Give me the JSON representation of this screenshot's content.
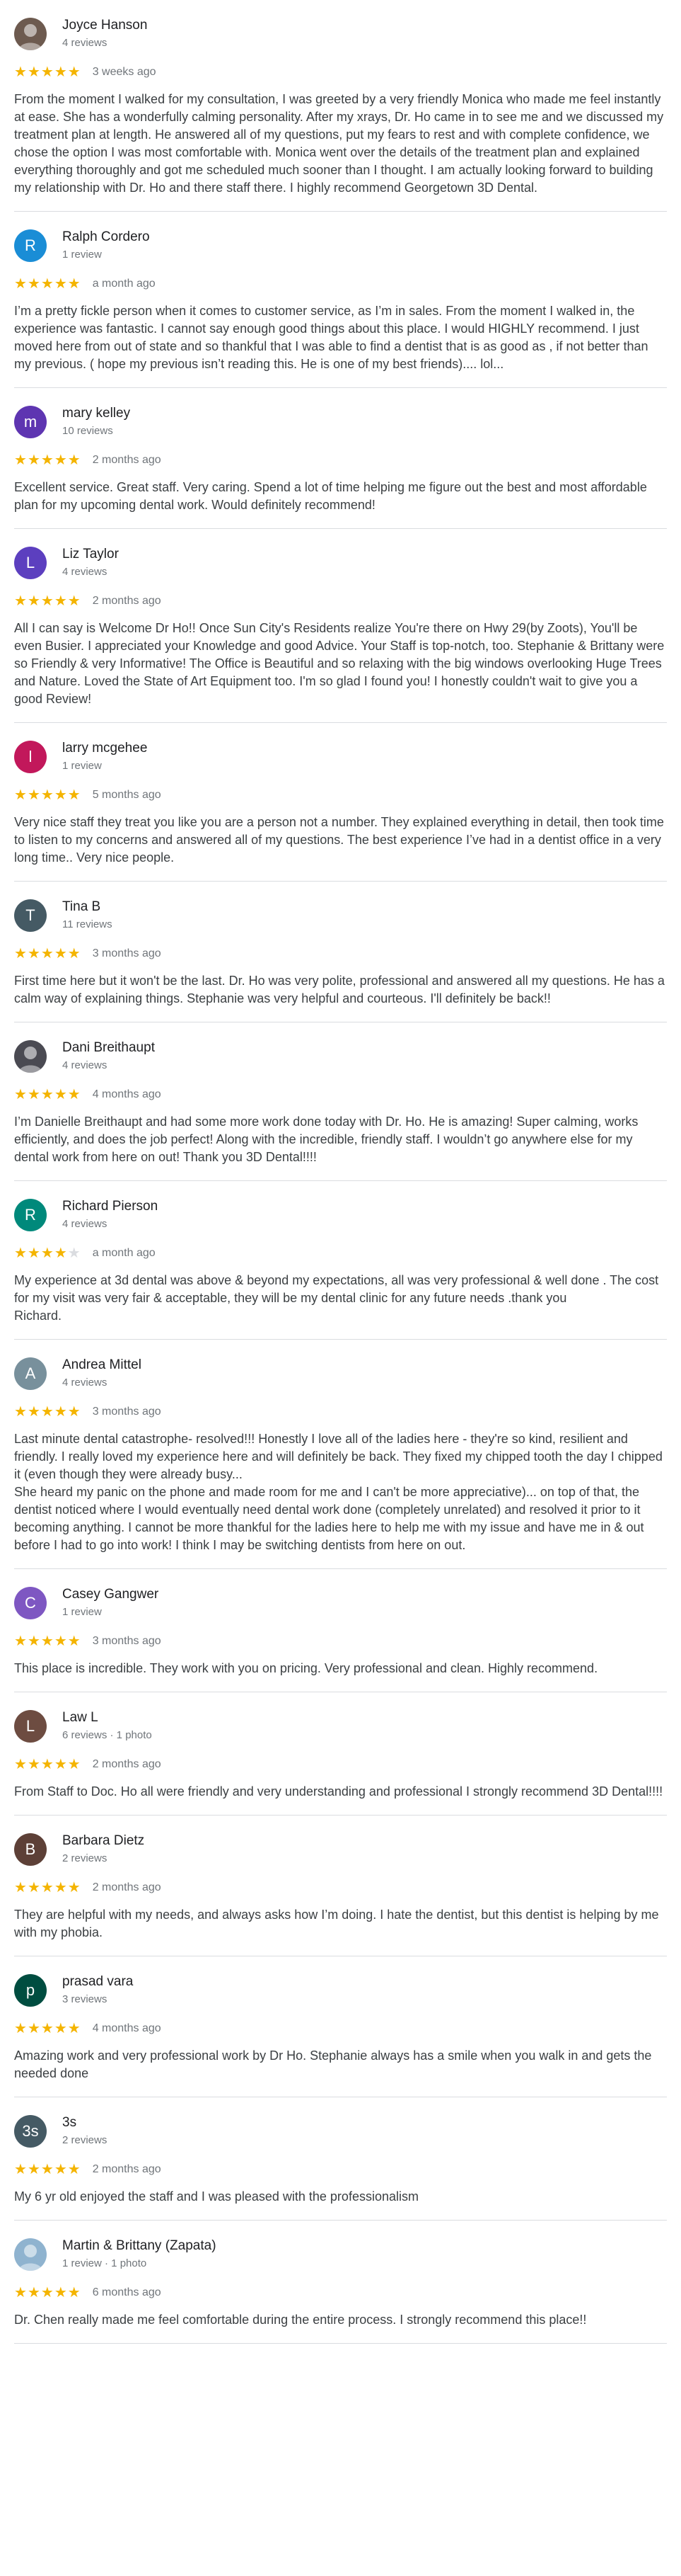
{
  "colors": {
    "star_filled": "#f4b400",
    "star_empty": "#dadce0",
    "divider": "#dadce0"
  },
  "reviews": [
    {
      "author": "Joyce Hanson",
      "meta": "4 reviews",
      "avatar": {
        "type": "photo",
        "icon": "profile-photo",
        "color": "#6d5a4f"
      },
      "rating": 5,
      "date": "3 weeks ago",
      "text": "From the moment I walked for my consultation, I was greeted by a very friendly Monica who made me feel instantly at ease. She has a wonderfully calming personality. After my xrays, Dr. Ho came in to see me and we discussed my treatment plan at length. He answered all of my questions, put my fears to rest and with complete confidence, we chose the option I was most comfortable with. Monica went over the details of the treatment plan and explained everything thoroughly and got me scheduled much sooner than I thought. I am actually looking forward to building my relationship with Dr. Ho and there staff there. I highly recommend Georgetown 3D Dental."
    },
    {
      "author": "Ralph Cordero",
      "meta": "1 review",
      "avatar": {
        "type": "letter",
        "letter": "R",
        "color": "#1a8dd6"
      },
      "rating": 5,
      "date": "a month ago",
      "text": "I’m a pretty fickle person when it comes to customer service, as I’m in sales. From the moment I walked in, the experience was fantastic.  I cannot say enough good things about this place. I would HIGHLY recommend. I just moved here from out of state and so thankful that I was able to find a dentist that is as good as , if not better than my previous. ( hope my previous isn’t reading this. He is one of my best friends).... lol..."
    },
    {
      "author": "mary kelley",
      "meta": "10 reviews",
      "avatar": {
        "type": "letter",
        "letter": "m",
        "color": "#5e35b1"
      },
      "rating": 5,
      "date": "2 months ago",
      "text": "Excellent service. Great staff. Very caring. Spend a lot of time helping me figure out the best and most affordable plan for my upcoming dental work. Would definitely recommend!"
    },
    {
      "author": "Liz Taylor",
      "meta": "4 reviews",
      "avatar": {
        "type": "letter",
        "letter": "L",
        "color": "#5c3fbf"
      },
      "rating": 5,
      "date": "2 months ago",
      "text": "All I can say is Welcome Dr Ho!! Once Sun City's Residents realize You're there on Hwy 29(by Zoots), You'll be even Busier. I appreciated your Knowledge and good Advice. Your Staff is top-notch, too. Stephanie & Brittany were so Friendly & very Informative! The Office is Beautiful and so relaxing with the big windows overlooking Huge Trees and Nature. Loved the State of Art Equipment too. I'm so glad I found you! I honestly couldn't wait to give you a good Review!"
    },
    {
      "author": "larry mcgehee",
      "meta": "1 review",
      "avatar": {
        "type": "letter",
        "letter": "l",
        "color": "#c2185b"
      },
      "rating": 5,
      "date": "5 months ago",
      "text": "Very nice staff they treat you like you are a person not a number. They explained everything in detail, then took time to listen to my concerns and answered all of my questions. The best experience I’ve had in a dentist office in a very long time.. Very nice people."
    },
    {
      "author": "Tina B",
      "meta": "11 reviews",
      "avatar": {
        "type": "letter",
        "letter": "T",
        "color": "#455a64"
      },
      "rating": 5,
      "date": "3 months ago",
      "text": "First time here but it won't be the last. Dr. Ho was very polite, professional and answered all my questions. He has a calm way of explaining things. Stephanie was very helpful and courteous. I'll definitely be back!!"
    },
    {
      "author": "Dani Breithaupt",
      "meta": "4 reviews",
      "avatar": {
        "type": "photo",
        "icon": "profile-photo",
        "color": "#4a4a52"
      },
      "rating": 5,
      "date": "4 months ago",
      "text": "I’m Danielle Breithaupt and had some more work done today with Dr. Ho. He is amazing! Super calming, works efficiently, and does the job perfect! Along with the incredible, friendly staff. I wouldn’t go anywhere else for my dental work from here on out! Thank you 3D Dental!!!!"
    },
    {
      "author": "Richard Pierson",
      "meta": "4 reviews",
      "avatar": {
        "type": "letter",
        "letter": "R",
        "color": "#00897b"
      },
      "rating": 4,
      "date": "a month ago",
      "text": "My experience at 3d dental  was above & beyond my expectations, all was very professional & well done . The cost for my visit was very fair & acceptable, they will be my dental clinic for any future needs .thank you\nRichard."
    },
    {
      "author": "Andrea Mittel",
      "meta": "4 reviews",
      "avatar": {
        "type": "letter",
        "letter": "A",
        "color": "#78909c"
      },
      "rating": 5,
      "date": "3 months ago",
      "text": "Last minute dental catastrophe- resolved!!! Honestly I love all of the ladies here - they're so kind, resilient and friendly. I really loved my experience here and will definitely be back. They fixed my chipped tooth the day I chipped it (even though they were already busy...\nShe heard my panic on the phone and made room for me and I can't be more appreciative)... on top of that, the dentist noticed where I would eventually need dental work done (completely unrelated) and resolved it prior to it becoming anything. I cannot be more thankful for the ladies here to help me with my issue and have me in & out before I had to go into work! I think I may be switching dentists from here on out."
    },
    {
      "author": "Casey Gangwer",
      "meta": "1 review",
      "avatar": {
        "type": "letter",
        "letter": "C",
        "color": "#7e57c2"
      },
      "rating": 5,
      "date": "3 months ago",
      "text": "This place is incredible. They work with you on pricing. Very professional and clean. Highly recommend."
    },
    {
      "author": "Law L",
      "meta": "6 reviews · 1 photo",
      "avatar": {
        "type": "letter",
        "letter": "L",
        "color": "#6d4c41"
      },
      "rating": 5,
      "date": "2 months ago",
      "text": "From Staff  to Doc. Ho all were friendly and very understanding and professional I strongly recommend  3D Dental!!!!"
    },
    {
      "author": "Barbara Dietz",
      "meta": "2 reviews",
      "avatar": {
        "type": "letter",
        "letter": "B",
        "color": "#5d4037"
      },
      "rating": 5,
      "date": "2 months ago",
      "text": "They are helpful with my needs, and always asks how I’m doing. I hate the dentist, but this dentist is helping by me with my phobia."
    },
    {
      "author": "prasad vara",
      "meta": "3 reviews",
      "avatar": {
        "type": "letter",
        "letter": "p",
        "color": "#004d40"
      },
      "rating": 5,
      "date": "4 months ago",
      "text": "Amazing work and very professional work by Dr Ho. Stephanie always has a smile when you walk in and gets the needed done"
    },
    {
      "author": "3s",
      "meta": "2 reviews",
      "avatar": {
        "type": "letter",
        "letter": "3s",
        "color": "#455a64"
      },
      "rating": 5,
      "date": "2 months ago",
      "text": "My 6 yr old enjoyed the staff and I was pleased with the professionalism"
    },
    {
      "author": "Martin & Brittany (Zapata)",
      "meta": "1 review · 1 photo",
      "avatar": {
        "type": "photo",
        "icon": "profile-photo",
        "color": "#8fb3cf"
      },
      "rating": 5,
      "date": "6 months ago",
      "text": "Dr. Chen really made me feel comfortable during the entire process. I strongly recommend this place!!"
    }
  ]
}
